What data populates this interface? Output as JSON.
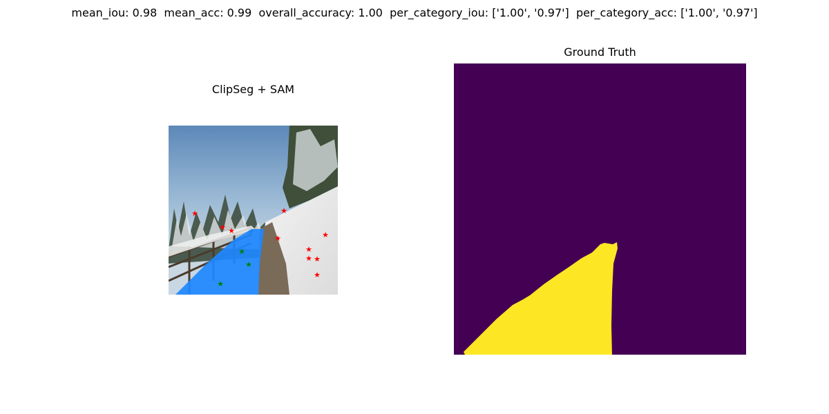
{
  "figure": {
    "suptitle": "mean_iou: 0.98  mean_acc: 0.99  overall_accuracy: 1.00  per_category_iou: ['1.00', '0.97']  per_category_acc: ['1.00', '0.97']"
  },
  "left_panel": {
    "title": "ClipSeg + SAM",
    "mask_color": "#1e88ff",
    "negative_point_color": "#ff0000",
    "positive_point_color": "#008000"
  },
  "right_panel": {
    "title": "Ground Truth",
    "background_color": "#440154",
    "foreground_color": "#fde725"
  }
}
